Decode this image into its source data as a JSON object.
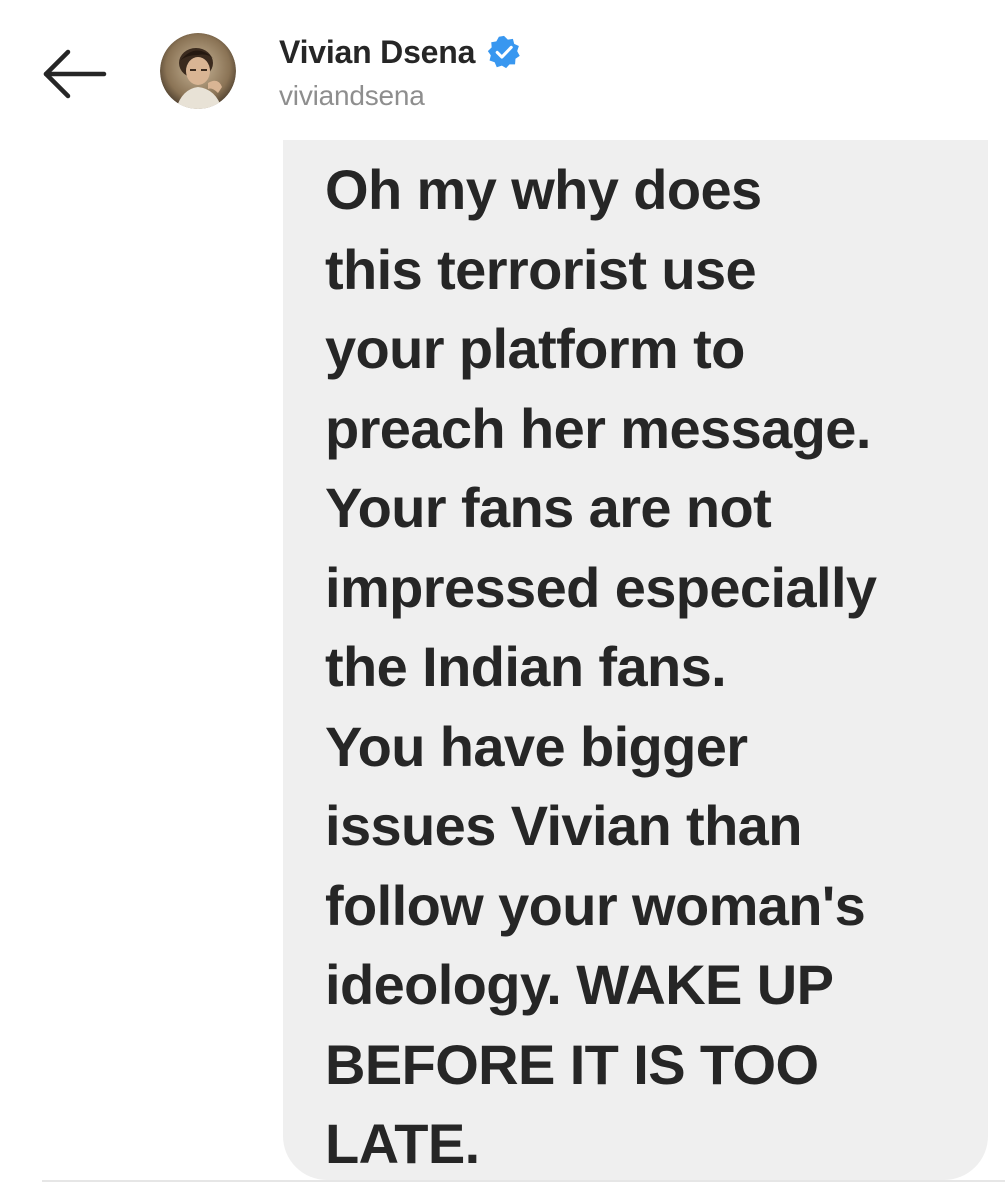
{
  "header": {
    "back_icon": "arrow-left-icon",
    "display_name": "Vivian Dsena",
    "verified_icon": "verified-badge-icon",
    "verified_color": "#3897f0",
    "username": "viviandsena",
    "avatar_icon": "profile-photo"
  },
  "message": {
    "text": "Oh my why does\nthis terrorist use\nyour platform to\npreach her message.\nYour fans are not\nimpressed especially\nthe Indian fans.\nYou have bigger\nissues Vivian than\nfollow your woman's\nideology. WAKE UP\nBEFORE IT IS TOO\nLATE.",
    "bubble_color": "#efefef"
  }
}
